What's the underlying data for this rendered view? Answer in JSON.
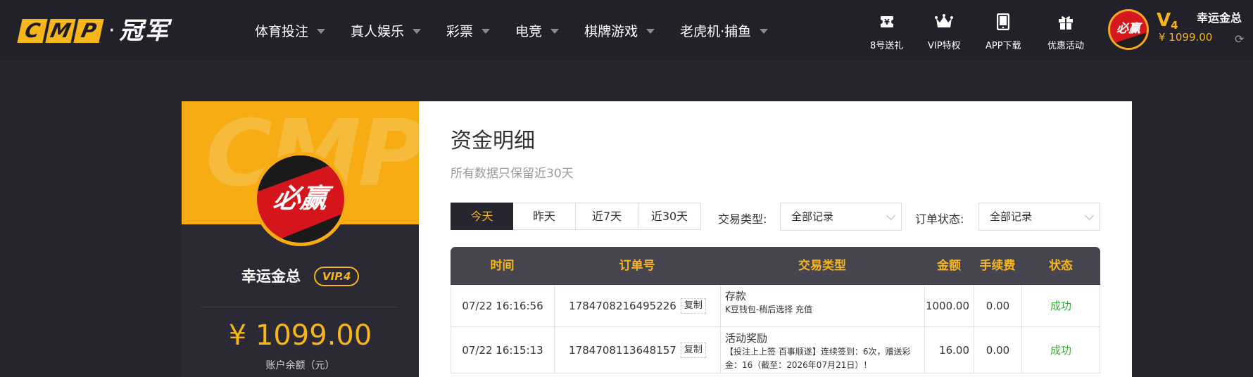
{
  "brand": {
    "logo_letters": [
      "C",
      "M",
      "P"
    ],
    "logo_dot": "·",
    "logo_text": "冠军"
  },
  "nav": [
    {
      "label": "体育投注"
    },
    {
      "label": "真人娱乐"
    },
    {
      "label": "彩票"
    },
    {
      "label": "电竞"
    },
    {
      "label": "棋牌游戏"
    },
    {
      "label": "老虎机·捕鱼"
    }
  ],
  "quick_links": [
    {
      "label": "8号送礼",
      "icon": "ticket-icon"
    },
    {
      "label": "VIP特权",
      "icon": "crown-icon"
    },
    {
      "label": "APP下载",
      "icon": "tablet-icon"
    },
    {
      "label": "优惠活动",
      "icon": "gift-icon"
    }
  ],
  "user": {
    "avatar_text": "必赢",
    "vip_level": "V",
    "vip_num": "4",
    "name": "幸运金总",
    "balance": "¥ 1099.00",
    "vip_badge": "VIP.4",
    "balance_big": "¥ 1099.00",
    "balance_label": "账户余额（元）"
  },
  "profile_watermark": "CMP",
  "page": {
    "title": "资金明细",
    "subtitle": "所有数据只保留近30天"
  },
  "tabs": [
    {
      "label": "今天",
      "active": true
    },
    {
      "label": "昨天",
      "active": false
    },
    {
      "label": "近7天",
      "active": false
    },
    {
      "label": "近30天",
      "active": false
    }
  ],
  "filters": {
    "type_label": "交易类型:",
    "type_value": "全部记录",
    "status_label": "订单状态:",
    "status_value": "全部记录"
  },
  "table": {
    "headers": [
      "时间",
      "订单号",
      "交易类型",
      "金额",
      "手续费",
      "状态"
    ],
    "copy_label": "复制",
    "rows": [
      {
        "time": "07/22 16:16:56",
        "order": "1784708216495226",
        "type_main": "存款",
        "type_sub": "K豆钱包-稍后选择 充值",
        "amount": "1000.00",
        "fee": "0.00",
        "status": "成功"
      },
      {
        "time": "07/22 16:15:13",
        "order": "1784708113648157",
        "type_main": "活动奖励",
        "type_sub": "【投注上上签 百事顺遂】连续签到：6次，赠送彩金：16（截至：2026年07月21日）！",
        "amount": "16.00",
        "fee": "0.00",
        "status": "成功"
      }
    ]
  },
  "colors": {
    "accent": "#f6b51a",
    "bg": "#26262f",
    "success": "#3aa63a",
    "brand_red": "#d4161c"
  }
}
